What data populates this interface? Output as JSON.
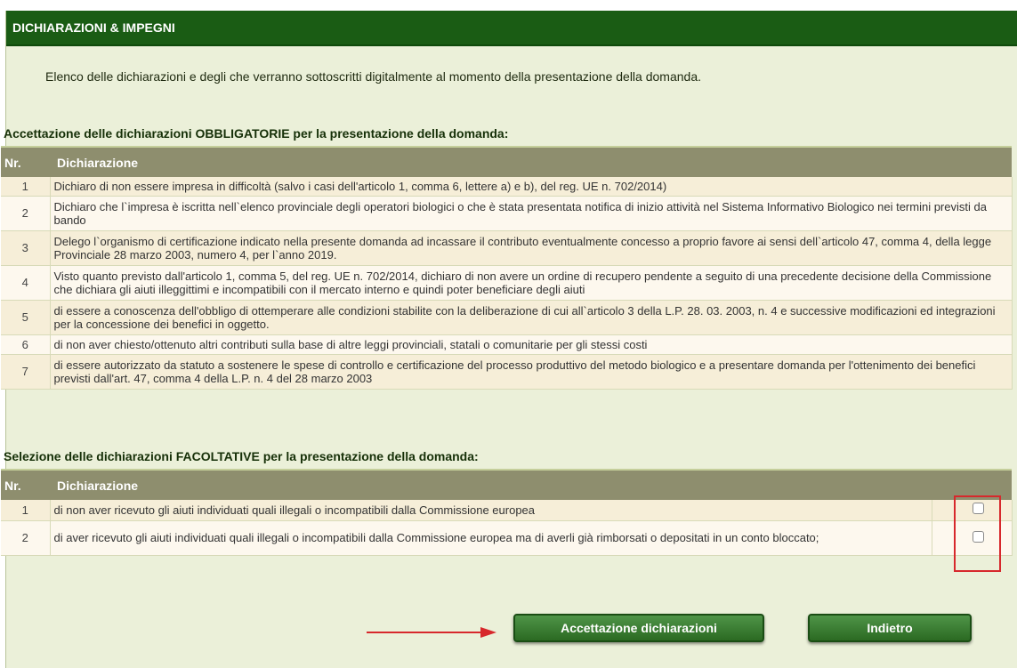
{
  "header": {
    "title": "DICHIARAZIONI & IMPEGNI"
  },
  "intro": "Elenco delle dichiarazioni e degli che verranno sottoscritti digitalmente al momento della presentazione della domanda.",
  "obbligatorie": {
    "title": "Accettazione delle dichiarazioni OBBLIGATORIE per la presentazione della domanda:",
    "columns": [
      "Nr.",
      "Dichiarazione"
    ],
    "rows": [
      {
        "nr": "1",
        "text": "Dichiaro di non essere impresa in difficoltà (salvo i casi dell'articolo 1, comma 6, lettere a) e b), del reg. UE n. 702/2014)"
      },
      {
        "nr": "2",
        "text": "Dichiaro che l`impresa è iscritta nell`elenco provinciale degli operatori biologici o che è stata presentata notifica di inizio attività nel Sistema Informativo Biologico nei termini previsti da bando"
      },
      {
        "nr": "3",
        "text": "Delego l`organismo di certificazione indicato nella presente domanda ad incassare il contributo eventualmente concesso a proprio favore ai sensi dell`articolo 47, comma 4, della legge Provinciale 28 marzo 2003, numero 4, per l`anno 2019."
      },
      {
        "nr": "4",
        "text": "Visto quanto previsto dall'articolo 1, comma 5, del reg. UE n. 702/2014, dichiaro di non avere un ordine di recupero pendente a seguito di una precedente decisione della Commissione che dichiara gli aiuti illeggittimi e incompatibili con il mercato interno e quindi poter beneficiare degli aiuti"
      },
      {
        "nr": "5",
        "text": "di essere a conoscenza dell'obbligo di ottemperare alle condizioni stabilite con la deliberazione di cui all`articolo 3 della L.P. 28. 03. 2003, n. 4 e successive modificazioni ed integrazioni per la concessione dei benefici in oggetto."
      },
      {
        "nr": "6",
        "text": "di non aver chiesto/ottenuto altri contributi sulla base di altre leggi provinciali, statali o comunitarie per gli stessi costi"
      },
      {
        "nr": "7",
        "text": "di essere autorizzato da statuto a sostenere le spese di controllo e certificazione del processo produttivo del metodo biologico e a presentare domanda per l'ottenimento dei benefici previsti dall'art. 47, comma 4 della L.P. n. 4 del 28 marzo 2003"
      }
    ]
  },
  "facoltative": {
    "title": "Selezione delle dichiarazioni FACOLTATIVE per la presentazione della domanda:",
    "columns": [
      "Nr.",
      "Dichiarazione"
    ],
    "rows": [
      {
        "nr": "1",
        "text": "di non aver ricevuto gli aiuti individuati quali illegali o incompatibili dalla Commissione europea",
        "checked": false
      },
      {
        "nr": "2",
        "text": "di aver ricevuto gli aiuti individuati quali illegali o incompatibili dalla Commissione europea ma di averli già rimborsati o depositati in un conto bloccato;",
        "checked": false
      }
    ]
  },
  "buttons": {
    "accept_label": "Accettazione dichiarazioni",
    "back_label": "Indietro"
  },
  "colors": {
    "header_bg": "#1a5c14",
    "panel_bg": "#ebf0d9",
    "table_header_bg": "#8e8e6e",
    "button_bg": "#2b6a22",
    "highlight_red": "#d7282c"
  }
}
